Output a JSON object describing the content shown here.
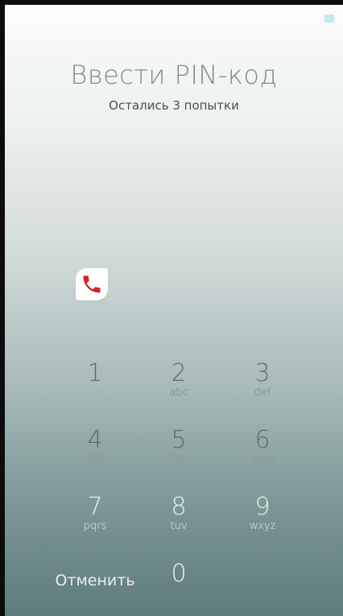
{
  "header": {
    "title": "Ввести PIN-код",
    "subtitle": "Остались 3 попытки"
  },
  "keypad": {
    "keys": [
      {
        "digit": "1",
        "letters": ""
      },
      {
        "digit": "2",
        "letters": "abc"
      },
      {
        "digit": "3",
        "letters": "def"
      },
      {
        "digit": "4",
        "letters": "ghi"
      },
      {
        "digit": "5",
        "letters": "jkl"
      },
      {
        "digit": "6",
        "letters": "mno"
      },
      {
        "digit": "7",
        "letters": "pqrs"
      },
      {
        "digit": "8",
        "letters": "tuv"
      },
      {
        "digit": "9",
        "letters": "wxyz"
      },
      {
        "digit": "0",
        "letters": ""
      }
    ],
    "cancel_label": "Отменить"
  },
  "icons": {
    "emergency_call": "phone-icon",
    "status_left": "notification-icon",
    "status_right": [
      "signal-icon",
      "battery-icon"
    ]
  },
  "colors": {
    "title": "#7d8a8a",
    "phone_red": "#d32323",
    "gradient_top": "#fbfcfc",
    "gradient_bottom": "#5f7b7b"
  }
}
